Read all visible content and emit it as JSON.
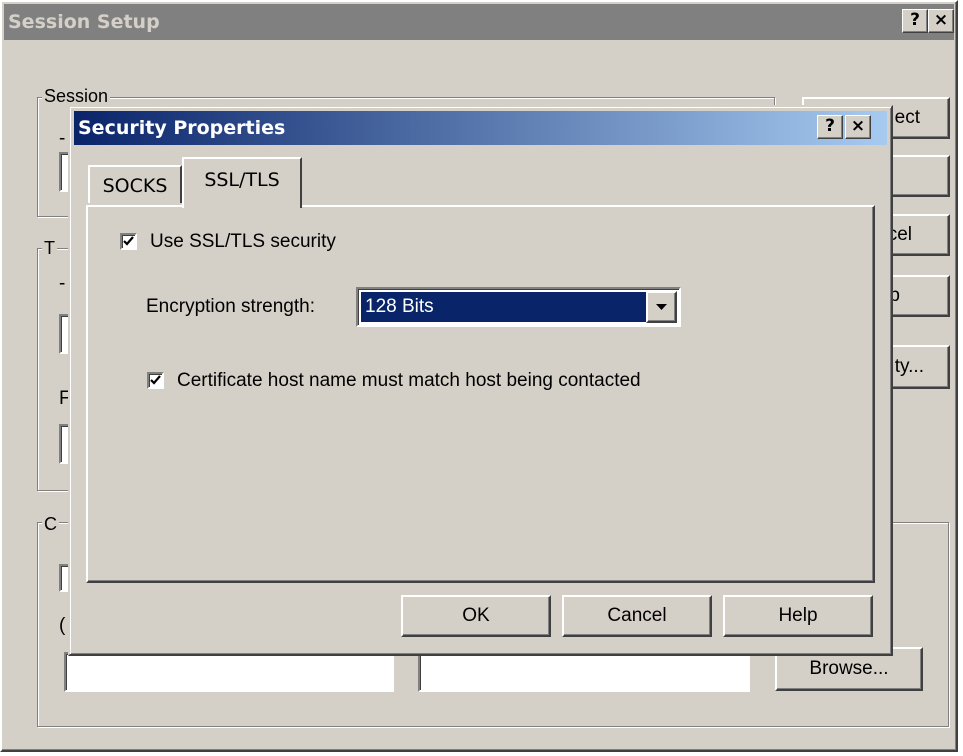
{
  "session_setup": {
    "title": "Session Setup",
    "help_glyph": "?",
    "close_glyph": "×",
    "groups": {
      "session_label": "Session",
      "group2_fragment": "T",
      "group3_fragment": "C"
    },
    "fragments": {
      "f1": "-",
      "f2": "-",
      "f3": "F",
      "f4": "("
    },
    "right_buttons": {
      "b1": "ect",
      "b2": "",
      "b3": "cel",
      "b4": "p",
      "b5": "ty..."
    },
    "browse_button": "Browse..."
  },
  "security_properties": {
    "title": "Security Properties",
    "help_glyph": "?",
    "close_glyph": "×",
    "tabs": [
      {
        "label": "SOCKS",
        "selected": false
      },
      {
        "label": "SSL/TLS",
        "selected": true
      }
    ],
    "use_ssl": {
      "label": "Use SSL/TLS security",
      "checked": true
    },
    "encryption": {
      "label": "Encryption strength:",
      "value": "128 Bits"
    },
    "cert_match": {
      "label": "Certificate host name must match host being contacted",
      "checked": true
    },
    "buttons": {
      "ok": "OK",
      "cancel": "Cancel",
      "help": "Help"
    }
  },
  "colors": {
    "face": "#d4d0c8",
    "active_title_start": "#0a246a",
    "active_title_end": "#a6caf0",
    "inactive_title": "#808080",
    "selection": "#0a246a"
  }
}
